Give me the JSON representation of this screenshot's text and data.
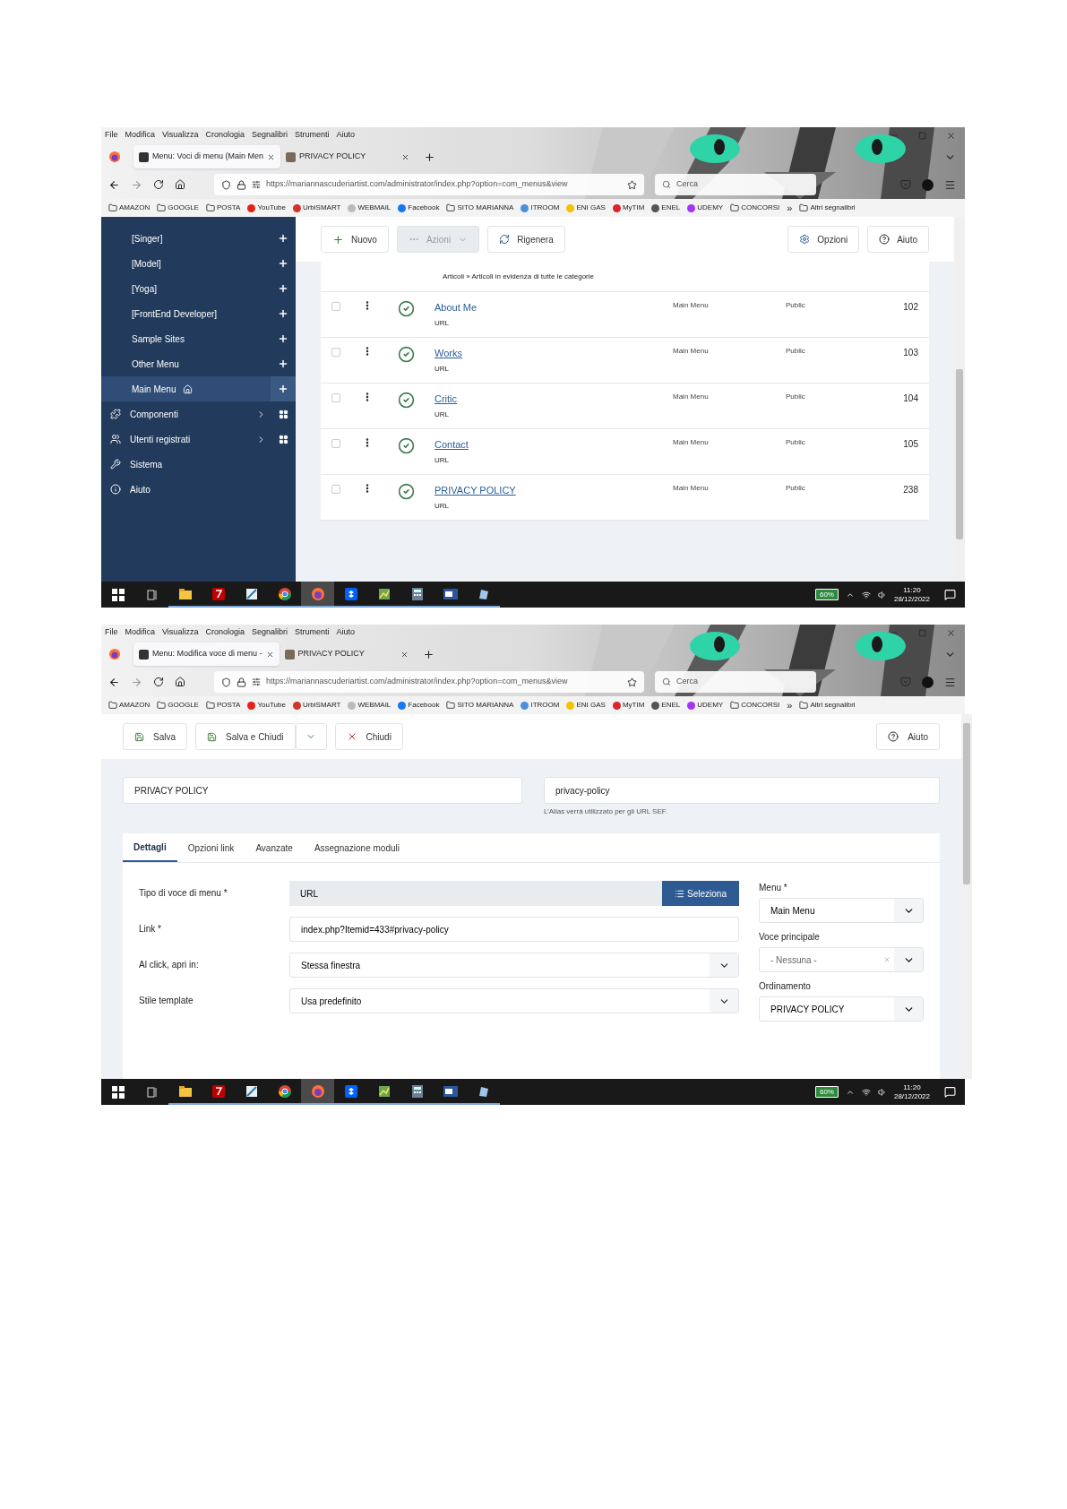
{
  "screenshots": [
    {
      "kind": "list",
      "browser": {
        "menu_bar": [
          "File",
          "Modifica",
          "Visualizza",
          "Cronologia",
          "Segnalibri",
          "Strumenti",
          "Aiuto"
        ],
        "tabs": [
          {
            "title": "Menu: Voci di menu (Main Men",
            "selected": true
          },
          {
            "title": "PRIVACY POLICY",
            "selected": false
          }
        ],
        "url": "https://mariannascuderiartist.com/administrator/index.php?option=com_menus&view",
        "search_placeholder": "Cerca",
        "bookmarks": [
          {
            "label": "AMAZON",
            "kind": "folder"
          },
          {
            "label": "GOOGLE",
            "kind": "folder"
          },
          {
            "label": "POSTA",
            "kind": "folder"
          },
          {
            "label": "YouTube",
            "kind": "site",
            "color": "#e62117"
          },
          {
            "label": "UrbiSMART",
            "kind": "site",
            "color": "#d0342c"
          },
          {
            "label": "WEBMAIL",
            "kind": "site",
            "color": "#bbbbbb"
          },
          {
            "label": "Facebook",
            "kind": "site",
            "color": "#1877f2"
          },
          {
            "label": "SITO MARIANNA",
            "kind": "folder"
          },
          {
            "label": "ITROOM",
            "kind": "site",
            "color": "#4a90d9"
          },
          {
            "label": "ENI GAS",
            "kind": "site",
            "color": "#f2c200"
          },
          {
            "label": "MyTIM",
            "kind": "site",
            "color": "#d9262c"
          },
          {
            "label": "ENEL",
            "kind": "site",
            "color": "#555555"
          },
          {
            "label": "UDEMY",
            "kind": "site",
            "color": "#a435f0"
          },
          {
            "label": "CONCORSI",
            "kind": "folder"
          }
        ],
        "overflow": "»",
        "more_bookmarks": "Altri segnalibri"
      },
      "sidebar": [
        {
          "label": "[Singer]",
          "kind": "submenu",
          "selected": false
        },
        {
          "label": "[Model]",
          "kind": "submenu",
          "selected": false
        },
        {
          "label": "[Yoga]",
          "kind": "submenu",
          "selected": false
        },
        {
          "label": "[FrontEnd Developer]",
          "kind": "submenu",
          "selected": false
        },
        {
          "label": "Sample Sites",
          "kind": "submenu",
          "selected": false
        },
        {
          "label": "Other Menu",
          "kind": "submenu",
          "selected": false
        },
        {
          "label": "Main Menu",
          "kind": "submenu",
          "selected": true
        },
        {
          "label": "Componenti",
          "kind": "components",
          "expandable": true
        },
        {
          "label": "Utenti registrati",
          "kind": "users",
          "expandable": true
        },
        {
          "label": "Sistema",
          "kind": "system",
          "expandable": false
        },
        {
          "label": "Aiuto",
          "kind": "help",
          "expandable": false
        }
      ],
      "toolbar": {
        "left": [
          {
            "label": "Nuovo",
            "kind": "new",
            "disabled": false
          },
          {
            "label": "Azioni",
            "kind": "actions",
            "disabled": true
          },
          {
            "label": "Rigenera",
            "kind": "rebuild",
            "disabled": false
          }
        ],
        "right": [
          {
            "label": "Opzioni",
            "kind": "options",
            "disabled": false
          },
          {
            "label": "Aiuto",
            "kind": "help",
            "disabled": false
          }
        ]
      },
      "table": {
        "partial_row": "Articoli » Articoli in evidenza di tutte le categorie",
        "rows": [
          {
            "title": "About Me",
            "type": "URL",
            "menu": "Main Menu",
            "access": "Public",
            "id": "102",
            "checked": false,
            "published": true,
            "underlined": false
          },
          {
            "title": "Works",
            "type": "URL",
            "menu": "Main Menu",
            "access": "Public",
            "id": "103",
            "checked": false,
            "published": true,
            "underlined": true
          },
          {
            "title": "Critic",
            "type": "URL",
            "menu": "Main Menu",
            "access": "Public",
            "id": "104",
            "checked": false,
            "published": true,
            "underlined": true
          },
          {
            "title": "Contact",
            "type": "URL",
            "menu": "Main Menu",
            "access": "Public",
            "id": "105",
            "checked": false,
            "published": true,
            "underlined": true
          },
          {
            "title": "PRIVACY POLICY",
            "type": "URL",
            "menu": "Main Menu",
            "access": "Public",
            "id": "238",
            "checked": false,
            "published": true,
            "underlined": true
          }
        ]
      },
      "taskbar": {
        "apps": [
          {
            "kind": "taskview",
            "selected": false
          },
          {
            "kind": "folder",
            "selected": false
          },
          {
            "kind": "ftp",
            "selected": false
          },
          {
            "kind": "paper",
            "selected": false
          },
          {
            "kind": "chrome",
            "selected": false
          },
          {
            "kind": "firefox",
            "selected": true
          },
          {
            "kind": "box",
            "selected": false
          },
          {
            "kind": "chart",
            "selected": false
          },
          {
            "kind": "calculator",
            "selected": false
          },
          {
            "kind": "document",
            "selected": false
          },
          {
            "kind": "pen",
            "selected": false
          }
        ],
        "battery": "60%",
        "time": "11:20",
        "date": "28/12/2022"
      }
    },
    {
      "kind": "edit",
      "browser": {
        "menu_bar": [
          "File",
          "Modifica",
          "Visualizza",
          "Cronologia",
          "Segnalibri",
          "Strumenti",
          "Aiuto"
        ],
        "tabs": [
          {
            "title": "Menu: Modifica voce di menu -",
            "selected": true
          },
          {
            "title": "PRIVACY POLICY",
            "selected": false
          }
        ],
        "url": "https://mariannascuderiartist.com/administrator/index.php?option=com_menus&view",
        "search_placeholder": "Cerca",
        "bookmarks": [
          {
            "label": "AMAZON",
            "kind": "folder"
          },
          {
            "label": "GOOGLE",
            "kind": "folder"
          },
          {
            "label": "POSTA",
            "kind": "folder"
          },
          {
            "label": "YouTube",
            "kind": "site",
            "color": "#e62117"
          },
          {
            "label": "UrbiSMART",
            "kind": "site",
            "color": "#d0342c"
          },
          {
            "label": "WEBMAIL",
            "kind": "site",
            "color": "#bbbbbb"
          },
          {
            "label": "Facebook",
            "kind": "site",
            "color": "#1877f2"
          },
          {
            "label": "SITO MARIANNA",
            "kind": "folder"
          },
          {
            "label": "ITROOM",
            "kind": "site",
            "color": "#4a90d9"
          },
          {
            "label": "ENI GAS",
            "kind": "site",
            "color": "#f2c200"
          },
          {
            "label": "MyTIM",
            "kind": "site",
            "color": "#d9262c"
          },
          {
            "label": "ENEL",
            "kind": "site",
            "color": "#555555"
          },
          {
            "label": "UDEMY",
            "kind": "site",
            "color": "#a435f0"
          },
          {
            "label": "CONCORSI",
            "kind": "folder"
          }
        ],
        "overflow": "»",
        "more_bookmarks": "Altri segnalibri"
      },
      "toolbar": {
        "left": [
          {
            "label": "Salva",
            "kind": "save",
            "split": false
          },
          {
            "label": "Salva e Chiudi",
            "kind": "save",
            "split": true
          },
          {
            "label": "Chiudi",
            "kind": "close",
            "split": false
          }
        ],
        "right": [
          {
            "label": "Aiuto",
            "kind": "help",
            "split": false
          }
        ]
      },
      "title_field": {
        "value": "PRIVACY POLICY"
      },
      "alias_field": {
        "value": "privacy-policy",
        "hint": "L’Alias verrà utilizzato per gli URL SEF."
      },
      "tabs": [
        {
          "label": "Dettagli",
          "selected": true
        },
        {
          "label": "Opzioni link",
          "selected": false
        },
        {
          "label": "Avanzate",
          "selected": false
        },
        {
          "label": "Assegnazione moduli",
          "selected": false
        }
      ],
      "fields": [
        {
          "label": "Tipo di voce di menu *",
          "kind": "picker",
          "value": "URL",
          "button": "Seleziona"
        },
        {
          "label": "Link *",
          "kind": "text",
          "value": "index.php?Itemid=433#privacy-policy"
        },
        {
          "label": "Al click, apri in:",
          "kind": "select",
          "value": "Stessa finestra"
        },
        {
          "label": "Stile template",
          "kind": "select",
          "value": "Usa predefinito"
        }
      ],
      "side_fields": [
        {
          "label": "Menu *",
          "value": "Main Menu",
          "clearable": false
        },
        {
          "label": "Voce principale",
          "value": "- Nessuna -",
          "clearable": true
        },
        {
          "label": "Ordinamento",
          "value": "PRIVACY POLICY",
          "clearable": false
        }
      ],
      "taskbar": {
        "apps": [
          {
            "kind": "taskview",
            "selected": false
          },
          {
            "kind": "folder",
            "selected": false
          },
          {
            "kind": "ftp",
            "selected": false
          },
          {
            "kind": "paper",
            "selected": false
          },
          {
            "kind": "chrome",
            "selected": false
          },
          {
            "kind": "firefox",
            "selected": true
          },
          {
            "kind": "box",
            "selected": false
          },
          {
            "kind": "chart",
            "selected": false
          },
          {
            "kind": "calculator",
            "selected": false
          },
          {
            "kind": "document",
            "selected": false
          },
          {
            "kind": "pen",
            "selected": false
          }
        ],
        "battery": "60%",
        "time": "11:20",
        "date": "28/12/2022"
      }
    }
  ]
}
